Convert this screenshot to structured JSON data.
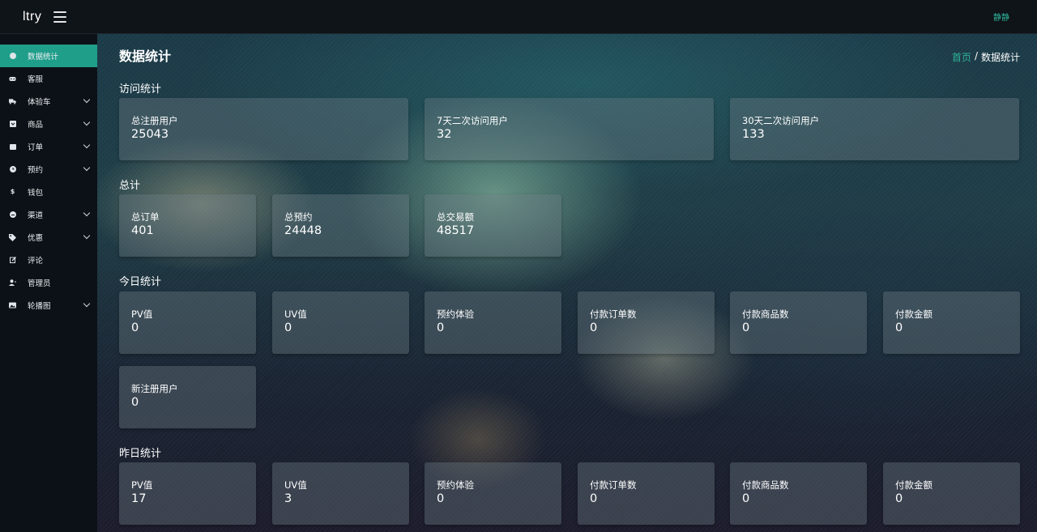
{
  "header": {
    "brand": "ltry",
    "user_name": "静静"
  },
  "sidebar": {
    "items": [
      {
        "label": "数据统计",
        "icon": "pie-chart-icon",
        "has_submenu": false,
        "active": true
      },
      {
        "label": "客服",
        "icon": "headset-icon",
        "has_submenu": false
      },
      {
        "label": "体验车",
        "icon": "truck-icon",
        "has_submenu": true
      },
      {
        "label": "商品",
        "icon": "product-icon",
        "has_submenu": true
      },
      {
        "label": "订单",
        "icon": "order-icon",
        "has_submenu": true
      },
      {
        "label": "预约",
        "icon": "clock-icon",
        "has_submenu": true
      },
      {
        "label": "钱包",
        "icon": "dollar-icon",
        "has_submenu": false
      },
      {
        "label": "渠道",
        "icon": "minus-circle-icon",
        "has_submenu": true
      },
      {
        "label": "优惠",
        "icon": "tag-icon",
        "has_submenu": true
      },
      {
        "label": "评论",
        "icon": "edit-icon",
        "has_submenu": false
      },
      {
        "label": "管理员",
        "icon": "user-icon",
        "has_submenu": false
      },
      {
        "label": "轮播图",
        "icon": "image-icon",
        "has_submenu": true
      }
    ]
  },
  "page": {
    "title": "数据统计",
    "breadcrumb": {
      "home": "首页",
      "separator": "/",
      "current": "数据统计"
    }
  },
  "sections": {
    "visit": {
      "title": "访问统计",
      "cards": [
        {
          "label": "总注册用户",
          "value": "25043"
        },
        {
          "label": "7天二次访问用户",
          "value": "32"
        },
        {
          "label": "30天二次访问用户",
          "value": "133"
        }
      ]
    },
    "total": {
      "title": "总计",
      "cards": [
        {
          "label": "总订单",
          "value": "401"
        },
        {
          "label": "总预约",
          "value": "24448"
        },
        {
          "label": "总交易额",
          "value": "48517"
        }
      ]
    },
    "today": {
      "title": "今日统计",
      "cards": [
        {
          "label": "PV值",
          "value": "0"
        },
        {
          "label": "UV值",
          "value": "0"
        },
        {
          "label": "预约体验",
          "value": "0"
        },
        {
          "label": "付款订单数",
          "value": "0"
        },
        {
          "label": "付款商品数",
          "value": "0"
        },
        {
          "label": "付款金额",
          "value": "0"
        },
        {
          "label": "新注册用户",
          "value": "0"
        }
      ]
    },
    "yesterday": {
      "title": "昨日统计",
      "cards": [
        {
          "label": "PV值",
          "value": "17"
        },
        {
          "label": "UV值",
          "value": "3"
        },
        {
          "label": "预约体验",
          "value": "0"
        },
        {
          "label": "付款订单数",
          "value": "0"
        },
        {
          "label": "付款商品数",
          "value": "0"
        },
        {
          "label": "付款金额",
          "value": "0"
        }
      ]
    }
  },
  "colors": {
    "accent": "#1f9e8a",
    "link": "#2fb39a",
    "sidebar_bg": "#0c1117",
    "topbar_bg": "#0f1419"
  }
}
